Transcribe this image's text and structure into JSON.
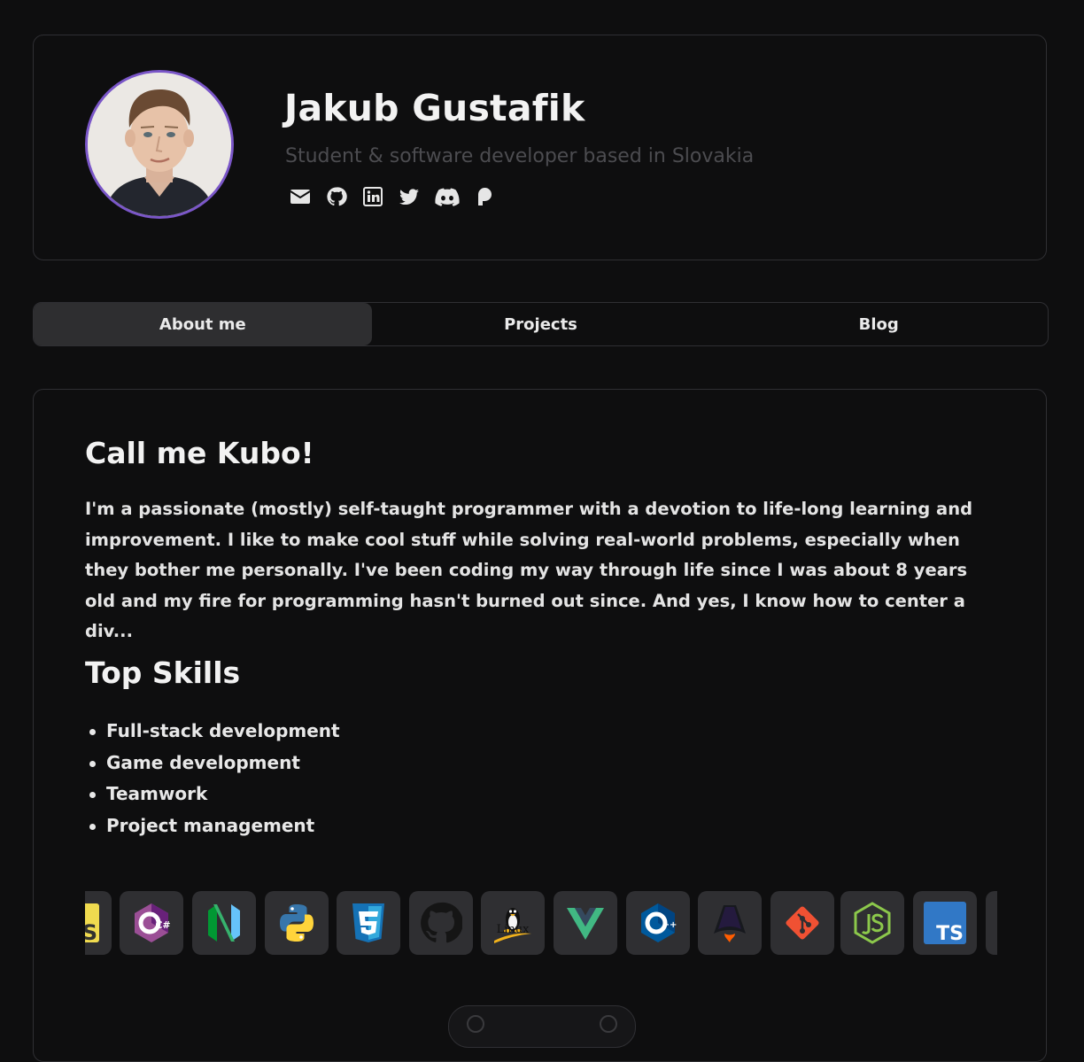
{
  "profile": {
    "name": "Jakub Gustafik",
    "tagline": "Student & software developer based in Slovakia",
    "accent": "#7a56c8",
    "socials": [
      {
        "icon": "mail-icon"
      },
      {
        "icon": "github-icon"
      },
      {
        "icon": "linkedin-icon"
      },
      {
        "icon": "twitter-icon"
      },
      {
        "icon": "discord-icon"
      },
      {
        "icon": "patreon-icon"
      }
    ]
  },
  "tabs": [
    {
      "label": "About me",
      "active": true
    },
    {
      "label": "Projects",
      "active": false
    },
    {
      "label": "Blog",
      "active": false
    }
  ],
  "about": {
    "heading": "Call me Kubo!",
    "bio": "I'm a passionate (mostly) self-taught programmer with a devotion to life-long learning and improvement. I like to make cool stuff while solving real-world problems, especially when they bother me personally. I've been coding my way through life since I was about 8 years old and my fire for programming hasn't burned out since. And yes, I know how to center a div...",
    "skills_heading": "Top Skills",
    "skills": [
      "Full-stack development",
      "Game development",
      "Teamwork",
      "Project management"
    ]
  },
  "tech_icons": [
    "javascript-icon",
    "csharp-icon",
    "neovim-icon",
    "python-icon",
    "css3-icon",
    "github-icon",
    "linux-icon",
    "vue-icon",
    "cplusplus-icon",
    "astro-icon",
    "git-icon",
    "nodejs-icon",
    "typescript-icon"
  ],
  "tech_labels": {
    "javascript": "S",
    "csharp": "C#",
    "linux": "Linux",
    "typescript": "TS",
    "cplusplus": "++"
  }
}
